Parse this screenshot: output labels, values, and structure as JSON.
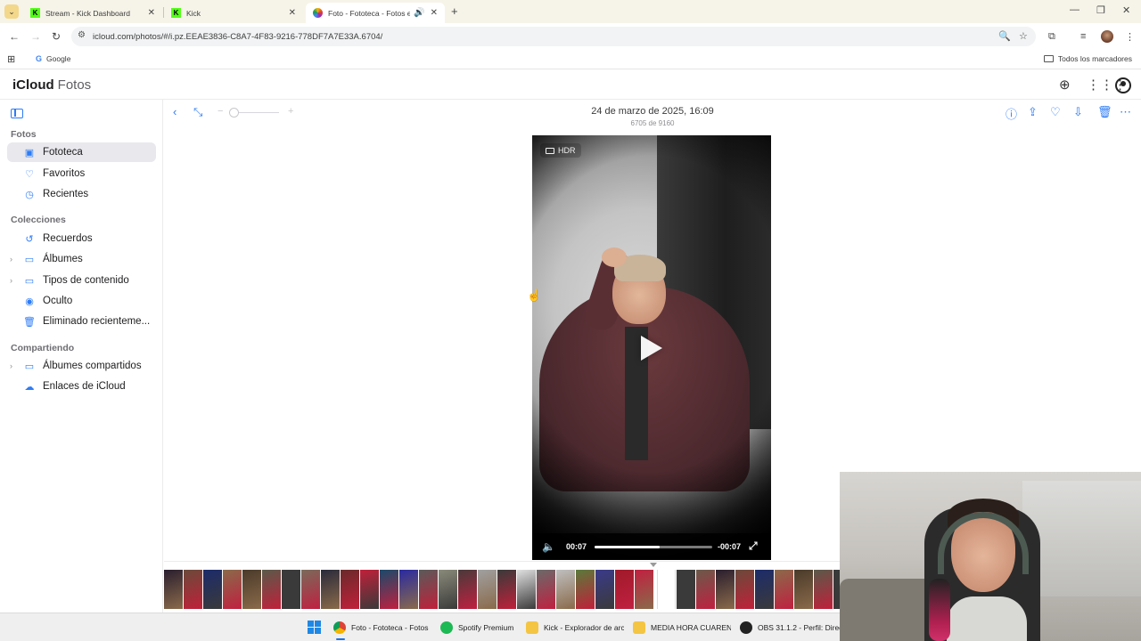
{
  "browser": {
    "tabs": [
      {
        "title": "Stream - Kick Dashboard",
        "active": false
      },
      {
        "title": "Kick",
        "active": false
      },
      {
        "title": "Foto - Fototeca - Fotos en i",
        "active": true
      }
    ],
    "url": "icloud.com/photos/#/i.pz.EEAE3836-C8A7-4F83-9216-778DF7A7E33A.6704/",
    "bookmarks": {
      "google": "Google",
      "all": "Todos los marcadores"
    }
  },
  "app": {
    "brand_icloud": "iCloud",
    "brand_fotos": "Fotos"
  },
  "sidebar": {
    "sections": {
      "fotos": "Fotos",
      "colecciones": "Colecciones",
      "compartiendo": "Compartiendo"
    },
    "items": [
      {
        "label": "Fototeca",
        "icon": "photo-library-icon",
        "selected": true
      },
      {
        "label": "Favoritos",
        "icon": "heart-icon"
      },
      {
        "label": "Recientes",
        "icon": "clock-icon"
      },
      {
        "label": "Recuerdos",
        "icon": "memories-icon"
      },
      {
        "label": "Álbumes",
        "icon": "album-icon",
        "expandable": true
      },
      {
        "label": "Tipos de contenido",
        "icon": "album-icon",
        "expandable": true
      },
      {
        "label": "Oculto",
        "icon": "eye-icon"
      },
      {
        "label": "Eliminado recienteme...",
        "icon": "trash-icon"
      },
      {
        "label": "Álbumes compartidos",
        "icon": "shared-album-icon",
        "expandable": true
      },
      {
        "label": "Enlaces de iCloud",
        "icon": "cloud-link-icon"
      }
    ]
  },
  "viewer": {
    "date": "24 de marzo de 2025, 16:09",
    "counter": "6705 de 9160",
    "hdr_label": "HDR",
    "time_elapsed": "00:07",
    "time_remaining": "-00:07",
    "progress_fraction": 0.55
  },
  "taskbar": {
    "items": [
      {
        "label": "Foto - Fototeca - Fotos",
        "color": "#4285f4"
      },
      {
        "label": "Spotify Premium",
        "color": "#1db954"
      },
      {
        "label": "Kick - Explorador de arc",
        "color": "#f4c542"
      },
      {
        "label": "MEDIA HORA CUARENT",
        "color": "#f4c542"
      },
      {
        "label": "OBS 31.1.2 - Perfil: Direct",
        "color": "#222222"
      }
    ]
  },
  "colors": {
    "accent": "#2e7cf6",
    "selected_bg": "#e8e8ed"
  }
}
